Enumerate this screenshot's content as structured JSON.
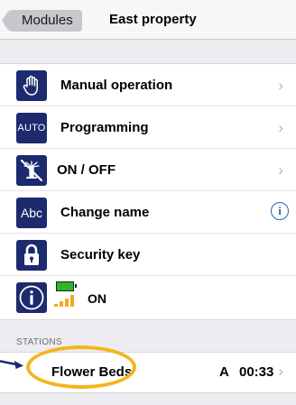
{
  "header": {
    "back_label": "Modules",
    "title": "East property"
  },
  "menu": [
    {
      "icon": "hand-icon",
      "label": "Manual operation"
    },
    {
      "icon": "auto-icon",
      "icon_text": "AUTO",
      "label": "Programming"
    },
    {
      "icon": "sprinkler-off-icon",
      "label": "ON / OFF"
    },
    {
      "icon": "abc-icon",
      "icon_text": "Abc",
      "label": "Change name"
    },
    {
      "icon": "lock-icon",
      "label": "Security key"
    },
    {
      "icon": "info-icon",
      "label": "ON",
      "battery_level": 1.0,
      "signal_bars": 4
    }
  ],
  "stations": {
    "header": "STATIONS",
    "items": [
      {
        "name": "Flower Beds",
        "mode": "A",
        "time": "00:33"
      }
    ]
  },
  "colors": {
    "tile": "#1d2a6e",
    "highlight": "#f3b51c",
    "info": "#1f6fb3",
    "battery": "#2cb52c",
    "signal": "#f2a81d"
  }
}
